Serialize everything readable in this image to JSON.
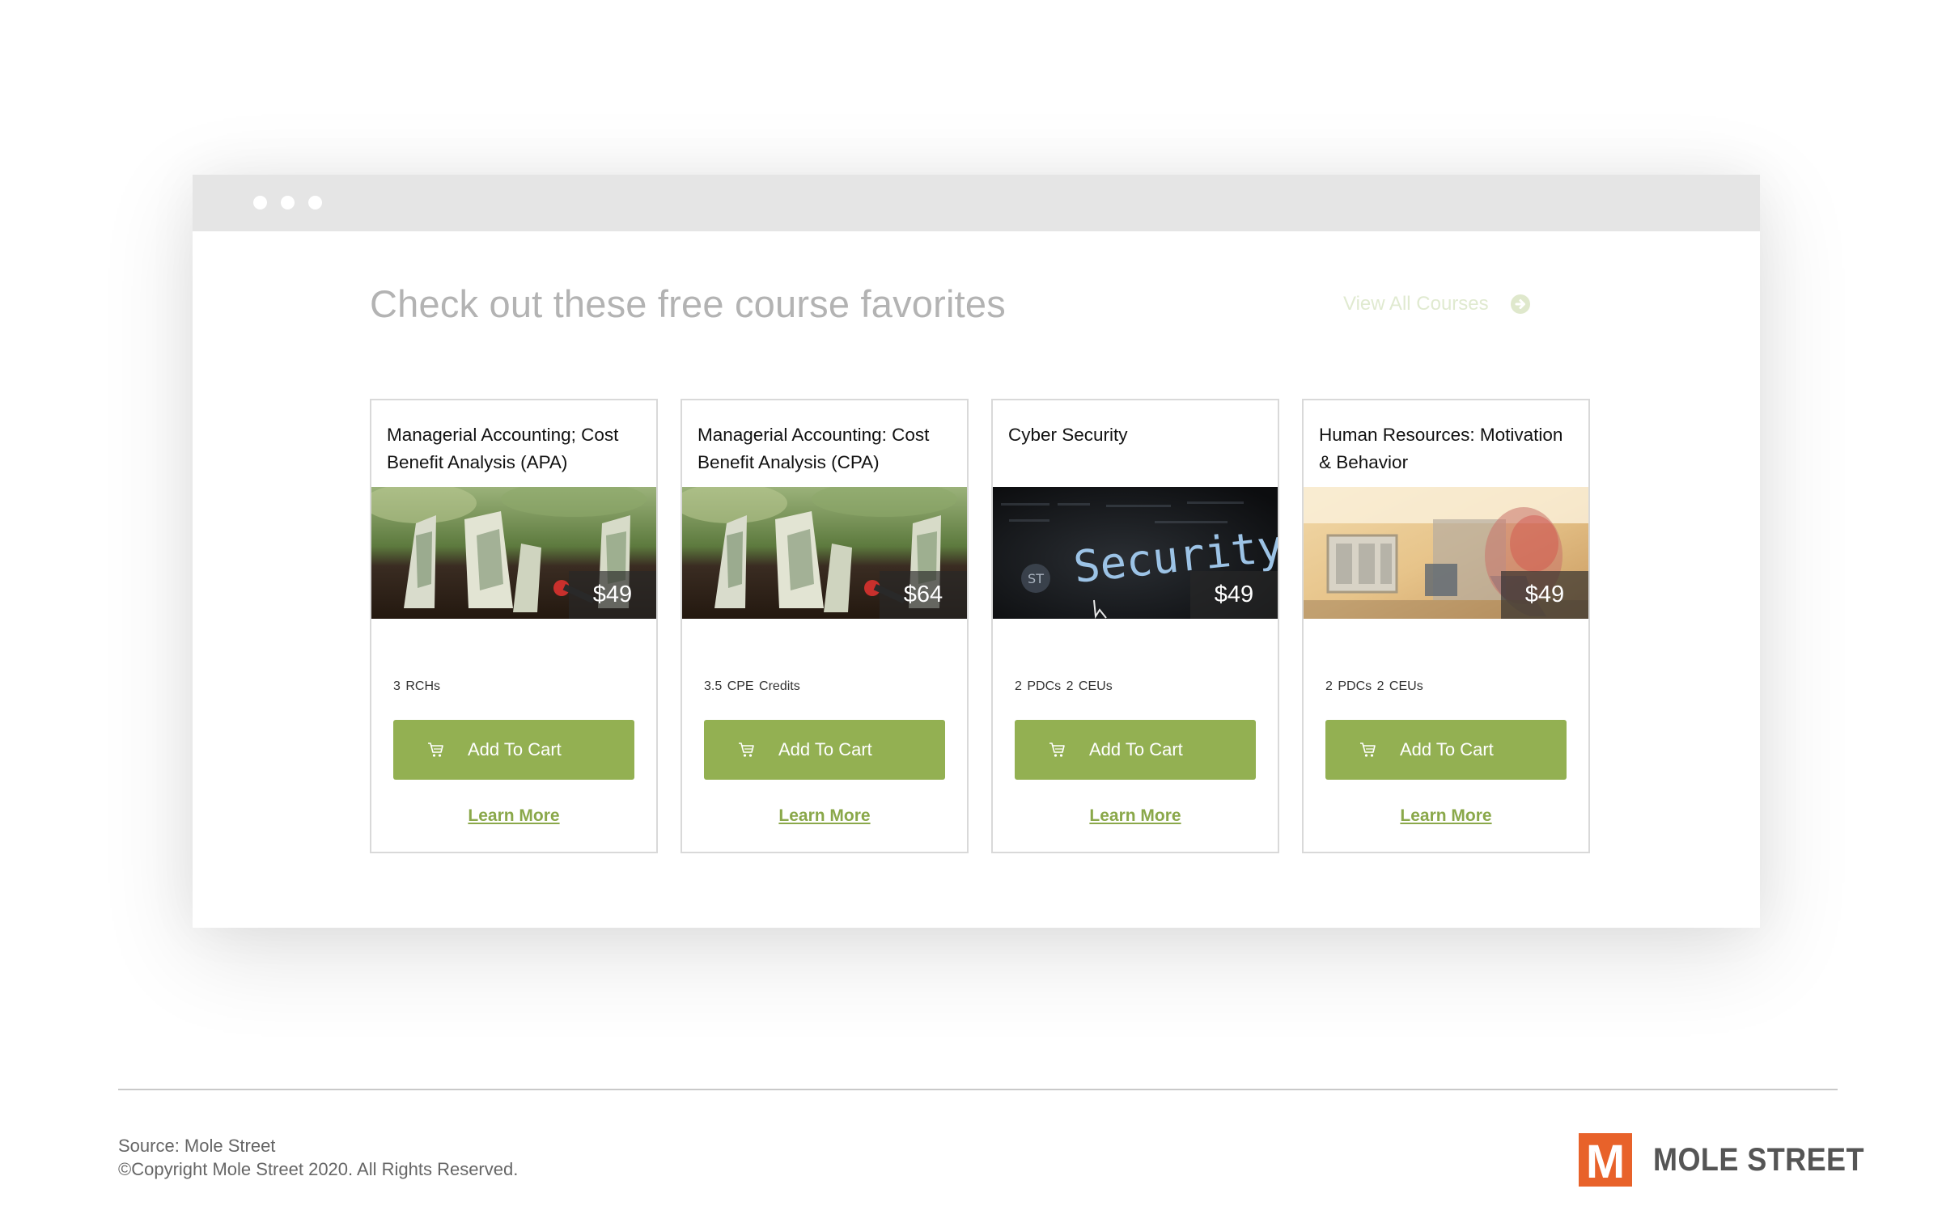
{
  "browser": {
    "heading": "Check out these free course favorites",
    "view_all_label": "View All Courses"
  },
  "courses": [
    {
      "title": "Managerial Accounting; Cost Benefit Analysis (APA)",
      "price": "$49",
      "credits": "3 RCHs",
      "cart_label": "Add To Cart",
      "learn_label": "Learn More",
      "image": "money-plant"
    },
    {
      "title": "Managerial Accounting: Cost Benefit Analysis (CPA)",
      "price": "$64",
      "credits": "3.5 CPE Credits",
      "cart_label": "Add To Cart",
      "learn_label": "Learn More",
      "image": "money-plant"
    },
    {
      "title": "Cyber Security",
      "price": "$49",
      "credits": "2 PDCs  2 CEUs",
      "cart_label": "Add To Cart",
      "learn_label": "Learn More",
      "image": "security-screen",
      "image_text": "Security"
    },
    {
      "title": "Human Resources: Motivation & Behavior",
      "price": "$49",
      "credits": "2 PDCs  2 CEUs",
      "cart_label": "Add To Cart",
      "learn_label": "Learn More",
      "image": "office-head"
    }
  ],
  "footer": {
    "source": "Source: Mole Street",
    "copyright": "©Copyright Mole Street 2020. All Rights Reserved.",
    "logo_text": "MOLE STREET",
    "logo_letter": "M"
  },
  "colors": {
    "accent_green": "#93b052",
    "link_green": "#8aa84a",
    "logo_orange": "#e8622a"
  }
}
